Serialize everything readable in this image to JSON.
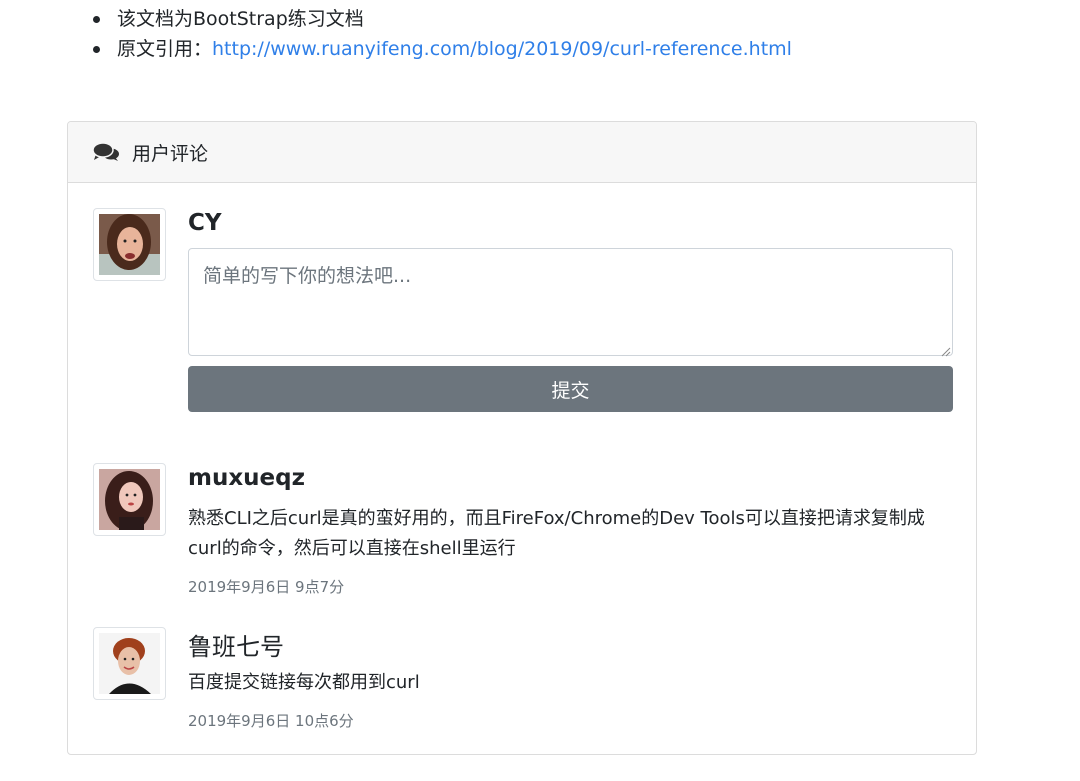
{
  "intro": {
    "line1": "该文档为BootStrap练习文档",
    "line2_label": "原文引用：",
    "line2_link": "http://www.ruanyifeng.com/blog/2019/09/curl-reference.html"
  },
  "card": {
    "header_icon": "comments-icon",
    "header_title": "用户评论"
  },
  "composer": {
    "user_name": "CY",
    "textarea_placeholder": "简单的写下你的想法吧...",
    "submit_label": "提交"
  },
  "comments": [
    {
      "author": "muxueqz",
      "text": "熟悉CLI之后curl是真的蛮好用的，而且FireFox/Chrome的Dev Tools可以直接把请求复制成curl的命令，然后可以直接在shell里运行",
      "time": "2019年9月6日 9点7分"
    },
    {
      "author": "鲁班七号",
      "text": "百度提交链接每次都用到curl",
      "time": "2019年9月6日 10点6分"
    }
  ],
  "colors": {
    "link": "#2f7fe8",
    "button": "#6c757d",
    "header_bg": "#f7f7f7",
    "muted_text": "#6c757d"
  }
}
